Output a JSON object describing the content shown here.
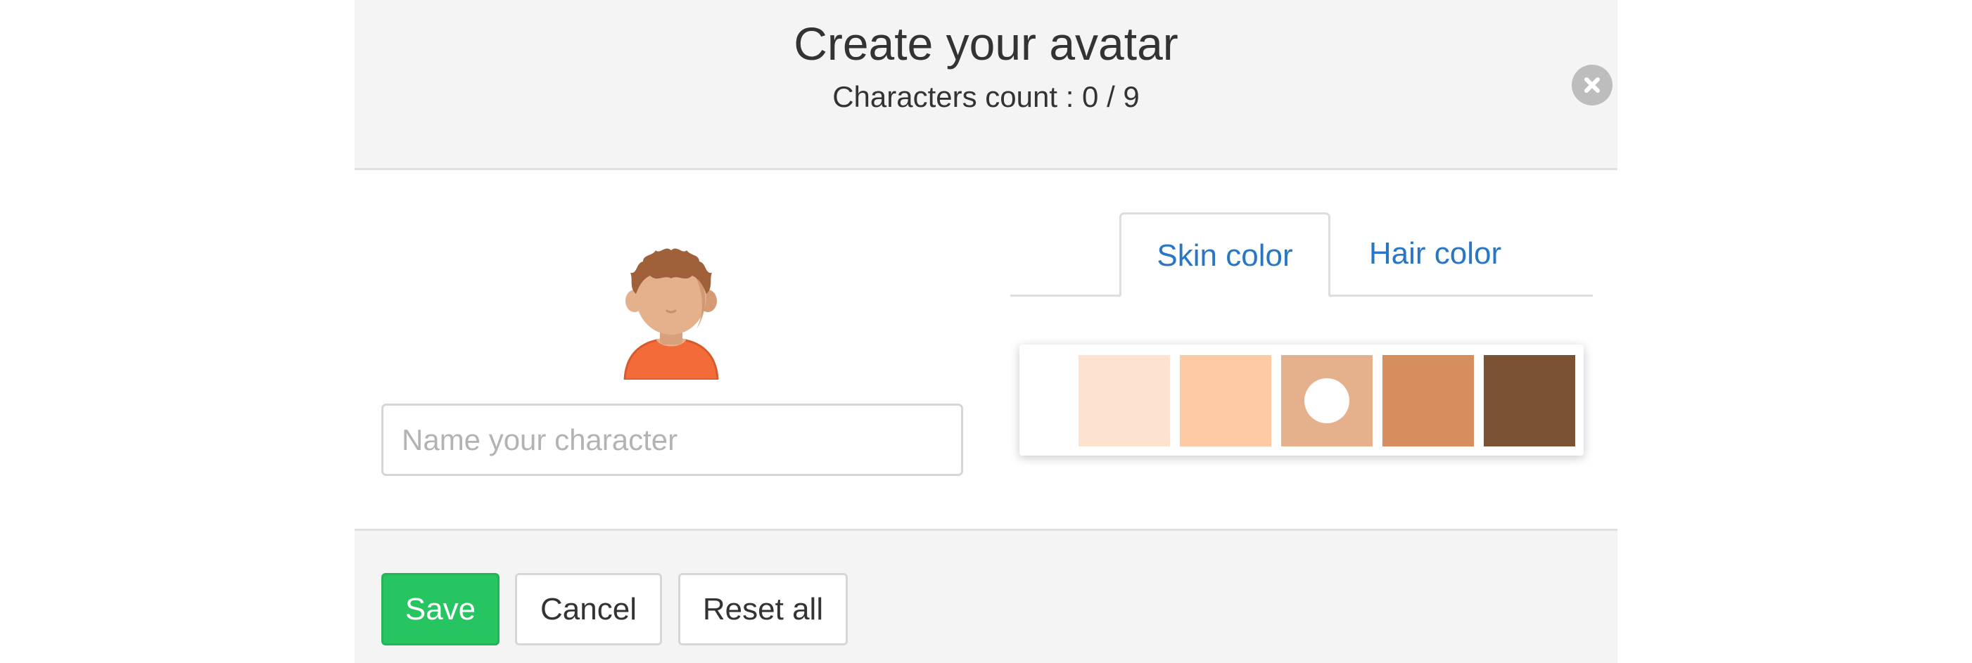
{
  "header": {
    "title": "Create your avatar",
    "characters_count_label": "Characters count : 0 / 9"
  },
  "close_icon": "close-icon",
  "avatar": {
    "icon": "avatar-icon",
    "skin_color": "#E8B08A",
    "hair_color": "#A0613A",
    "shirt_color": "#F26B38"
  },
  "name_input": {
    "placeholder": "Name your character",
    "value": ""
  },
  "tabs": [
    {
      "label": "Skin color",
      "active": true
    },
    {
      "label": "Hair color",
      "active": false
    }
  ],
  "skin_swatches": [
    {
      "color": "#FFFFFF",
      "selected": false
    },
    {
      "color": "#FDE3CF",
      "selected": false
    },
    {
      "color": "#FDCAA3",
      "selected": false
    },
    {
      "color": "#E5B08C",
      "selected": true
    },
    {
      "color": "#D68E5E",
      "selected": false
    },
    {
      "color": "#7B5233",
      "selected": false
    }
  ],
  "footer": {
    "save_label": "Save",
    "cancel_label": "Cancel",
    "reset_label": "Reset all"
  },
  "colors": {
    "accent_blue": "#2A76C6",
    "save_green": "#27C561"
  }
}
